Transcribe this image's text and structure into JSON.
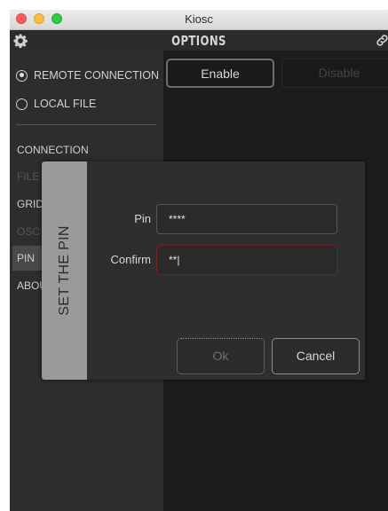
{
  "window": {
    "title": "Kiosc"
  },
  "toolbar": {
    "title": "OPTIONS",
    "left_icon": "gear-icon",
    "right_icon": "link-icon"
  },
  "sidebar": {
    "sources": [
      {
        "label": "REMOTE CONNECTION",
        "selected": true
      },
      {
        "label": "LOCAL FILE",
        "selected": false
      }
    ],
    "nav": [
      {
        "label": "CONNECTION",
        "state": "normal"
      },
      {
        "label": "FILE",
        "state": "disabled"
      },
      {
        "label": "GRID",
        "state": "normal"
      },
      {
        "label": "OSC",
        "state": "disabled"
      },
      {
        "label": "PIN",
        "state": "selected"
      },
      {
        "label": "ABOUT",
        "state": "normal"
      }
    ]
  },
  "content": {
    "enable_label": "Enable",
    "disable_label": "Disable"
  },
  "dialog": {
    "title": "SET THE PIN",
    "pin_label": "Pin",
    "pin_value": "****",
    "confirm_label": "Confirm",
    "confirm_value": "**|",
    "ok_label": "Ok",
    "cancel_label": "Cancel"
  },
  "colors": {
    "window_bg": "#1c1c1c",
    "sidebar_bg": "#2d2d2d",
    "dialog_bg": "#2e2e2e",
    "dialog_side": "#9a9a9a",
    "error_border": "#6b2323"
  }
}
